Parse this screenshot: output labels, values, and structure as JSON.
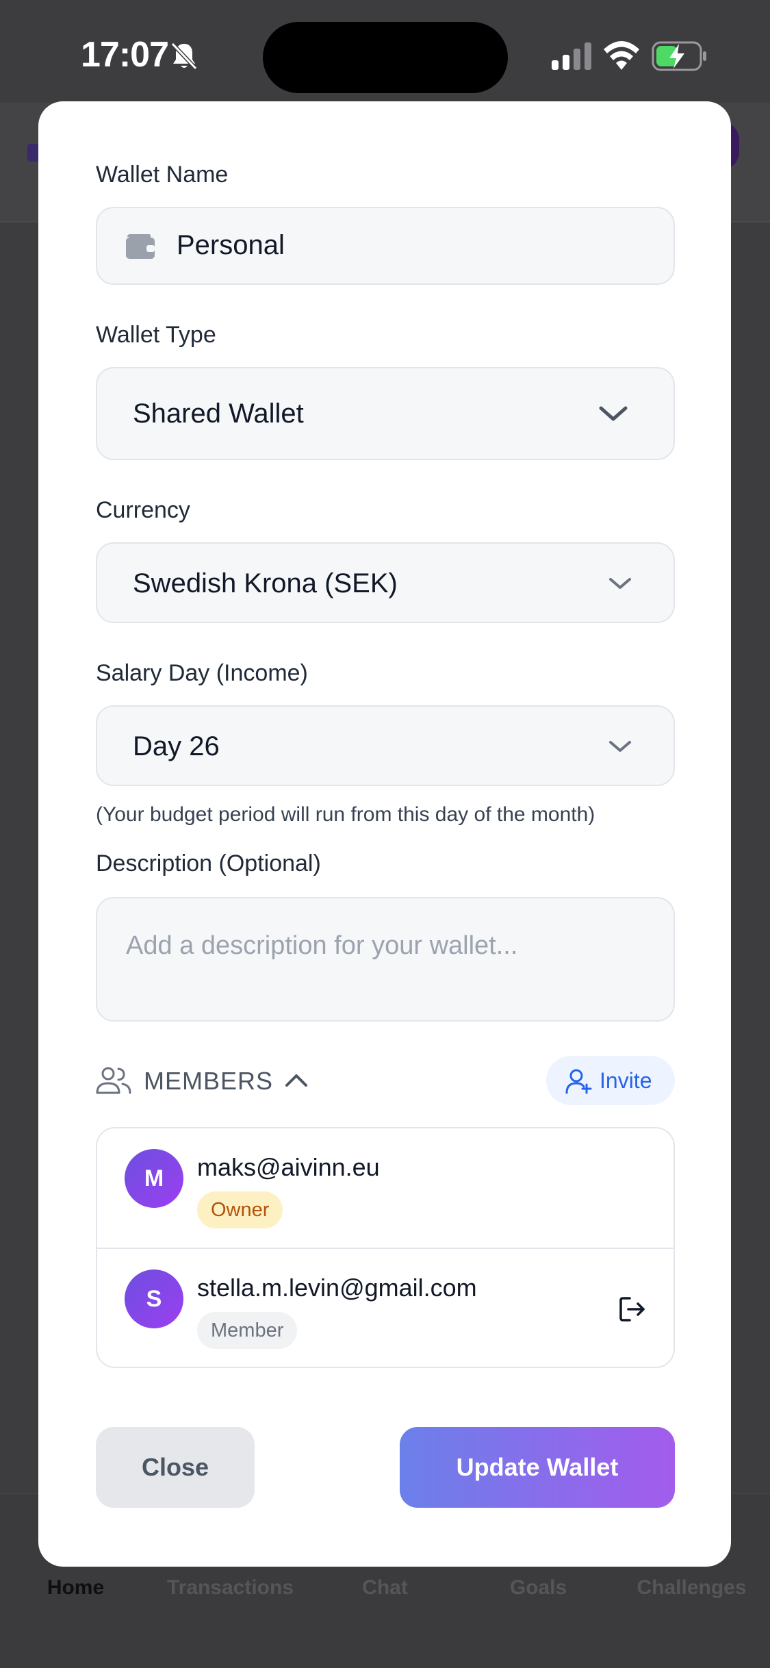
{
  "status_bar": {
    "time": "17:07"
  },
  "bottom_nav": {
    "items": [
      {
        "label": "Home",
        "active": true
      },
      {
        "label": "Transactions",
        "active": false
      },
      {
        "label": "Chat",
        "active": false
      },
      {
        "label": "Goals",
        "active": false
      },
      {
        "label": "Challenges",
        "active": false
      }
    ]
  },
  "form": {
    "wallet_name": {
      "label": "Wallet Name",
      "value": "Personal",
      "icon": "wallet-icon"
    },
    "wallet_type": {
      "label": "Wallet Type",
      "value": "Shared Wallet"
    },
    "currency": {
      "label": "Currency",
      "value": "Swedish Krona (SEK)"
    },
    "salary_day": {
      "label": "Salary Day (Income)",
      "value": "Day 26",
      "hint": "(Your budget period will run from this day of the month)"
    },
    "description": {
      "label": "Description (Optional)",
      "placeholder": "Add a description for your wallet..."
    }
  },
  "members": {
    "title": "MEMBERS",
    "invite_label": "Invite",
    "list": [
      {
        "initial": "M",
        "email": "maks@aivinn.eu",
        "role": "Owner"
      },
      {
        "initial": "S",
        "email": "stella.m.levin@gmail.com",
        "role": "Member"
      }
    ]
  },
  "actions": {
    "close_label": "Close",
    "update_label": "Update Wallet"
  },
  "colors": {
    "accent_start": "#6b80ea",
    "accent_end": "#a35cec",
    "owner_badge_bg": "#fdf1c4",
    "owner_badge_text": "#b45309",
    "invite_text": "#2563eb",
    "avatar_gradient_start": "#6d4fe0",
    "avatar_gradient_end": "#9b3ff0"
  }
}
